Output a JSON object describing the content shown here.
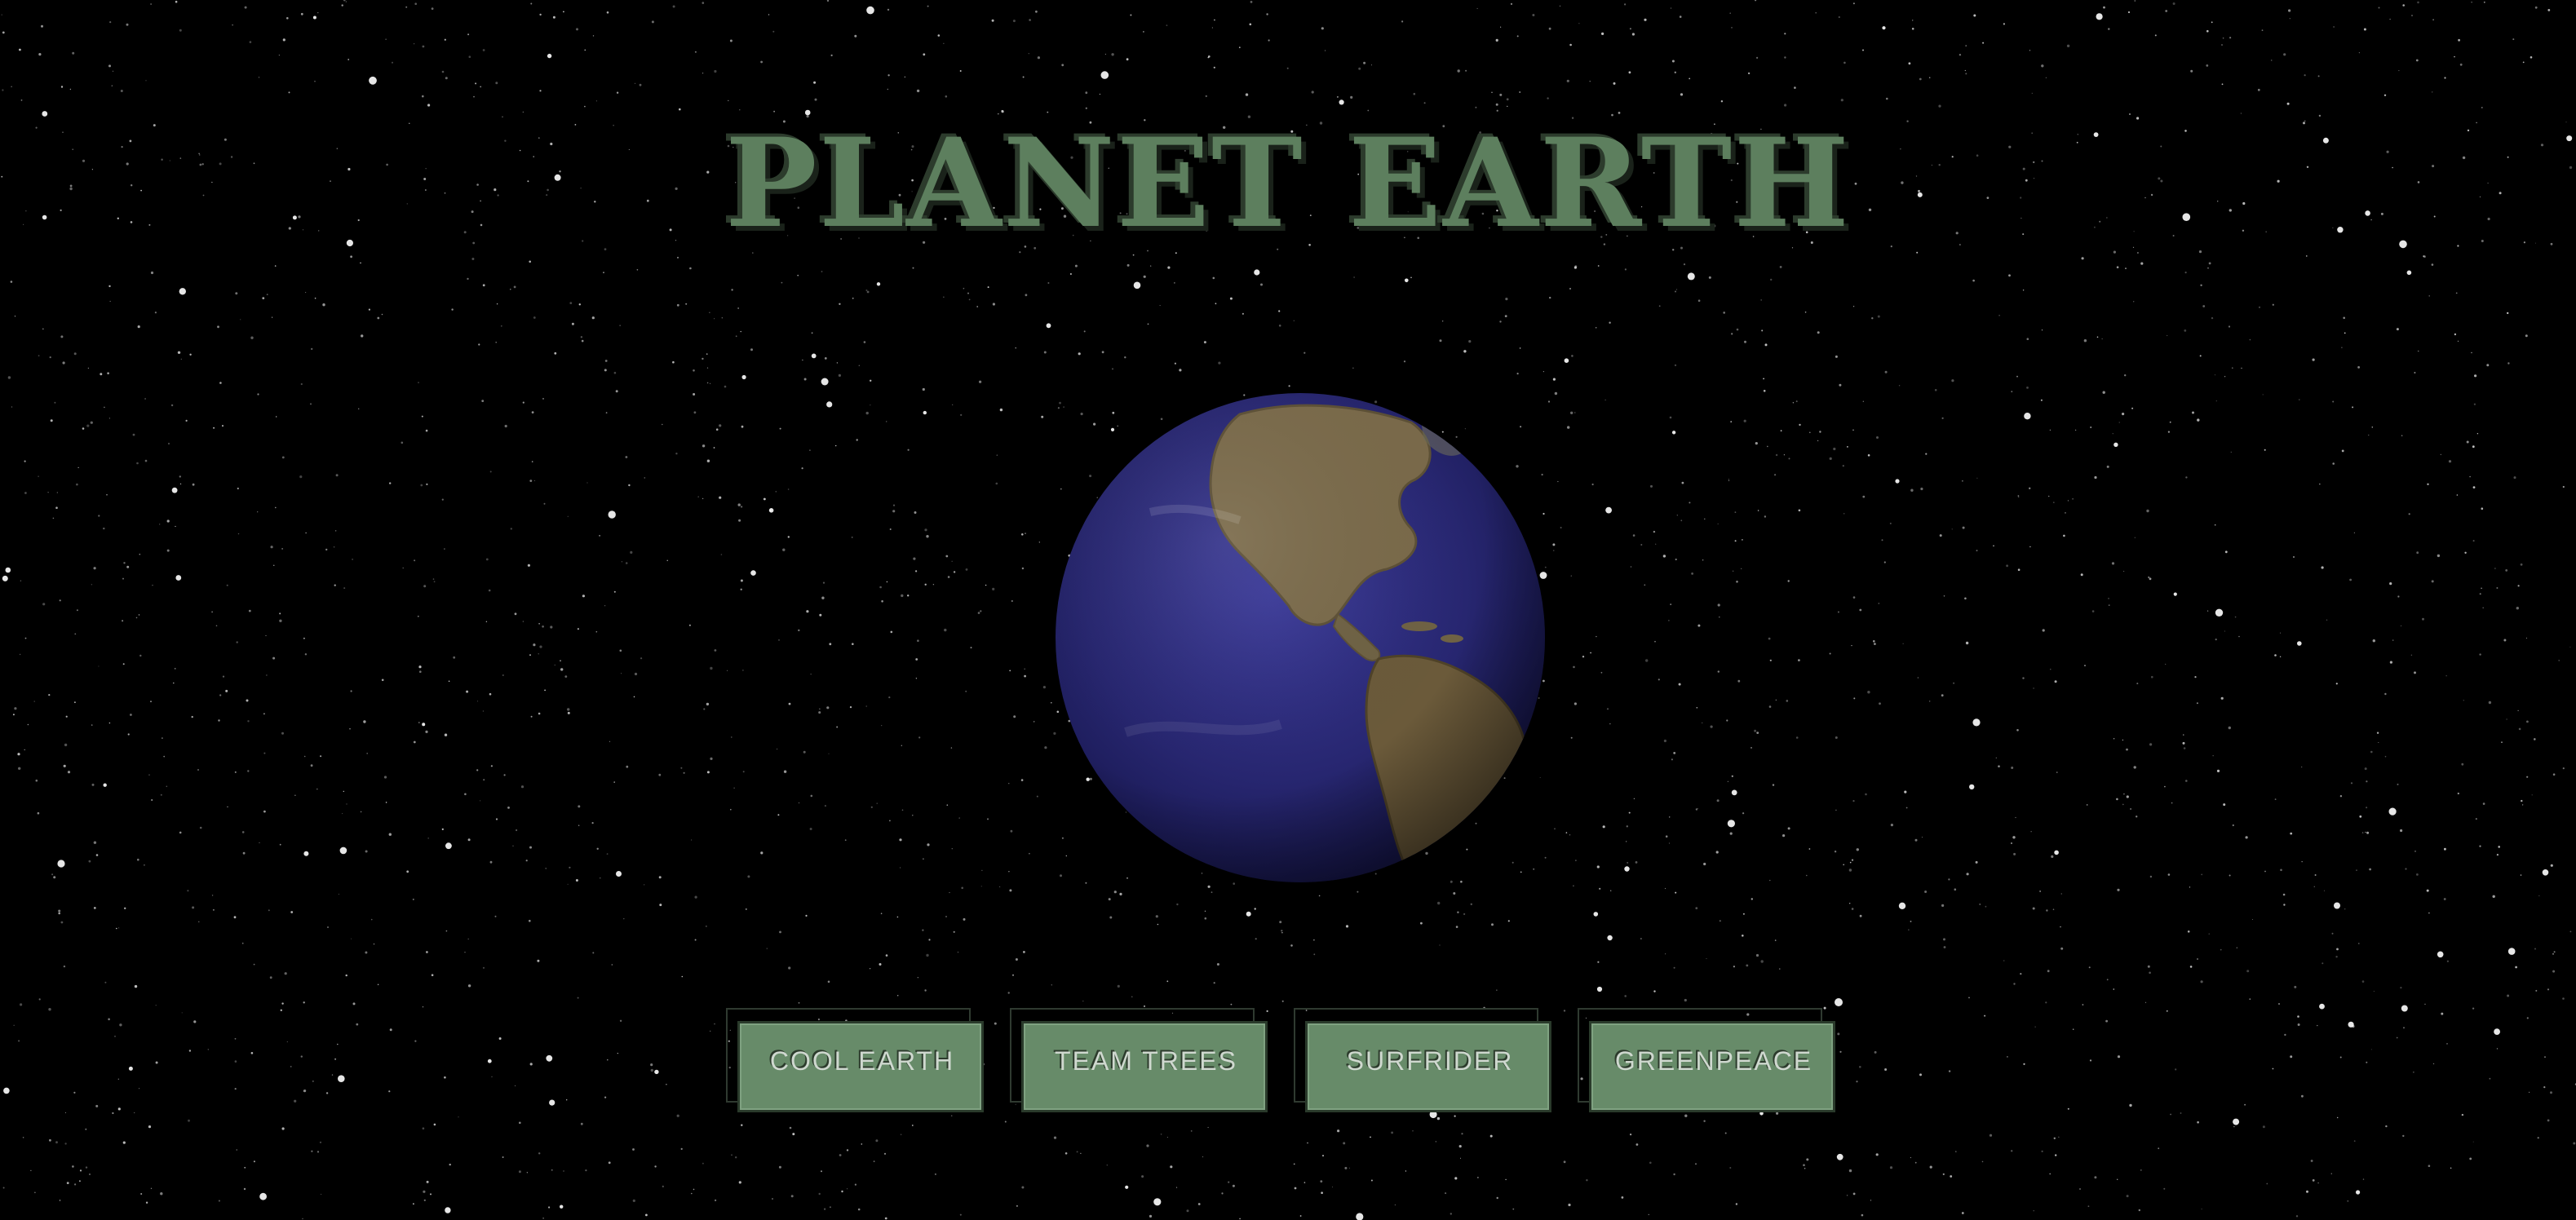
{
  "title": "PLANET EARTH",
  "colors": {
    "background": "#000000",
    "title_green": "#5d7f5e",
    "button_green": "#678b69",
    "globe_glow": "#ff0000",
    "ocean": "#2b2a7a",
    "land": "#7a6a4a"
  },
  "globe": {
    "icon": "earth-globe-icon"
  },
  "buttons": [
    {
      "label": "COOL EARTH"
    },
    {
      "label": "TEAM TREES"
    },
    {
      "label": "SURFRIDER"
    },
    {
      "label": "GREENPEACE"
    }
  ]
}
